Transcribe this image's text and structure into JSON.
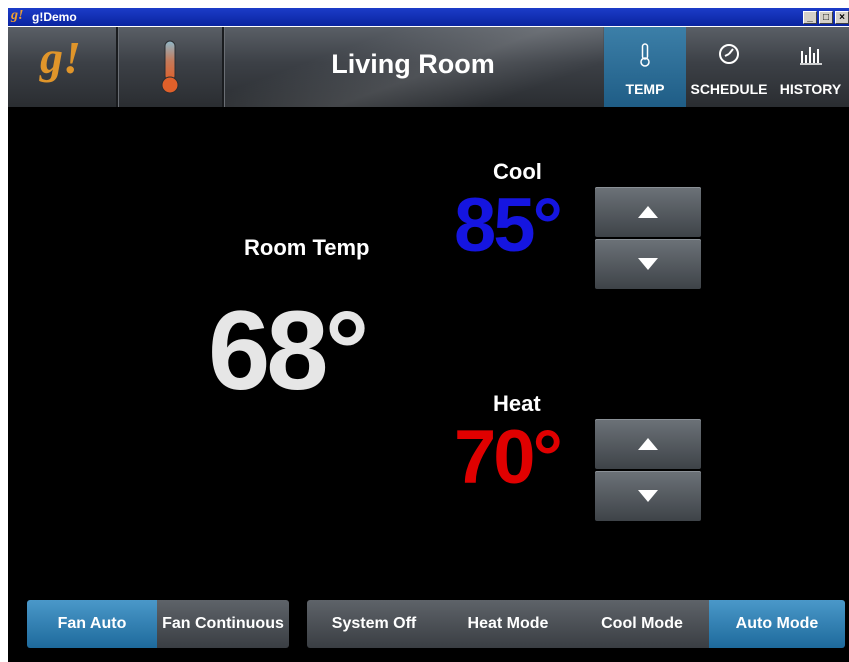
{
  "window": {
    "title": "g!Demo",
    "logo_text": "g!",
    "controls": [
      "_",
      "□",
      "×"
    ]
  },
  "header": {
    "brand": "g!",
    "room_name": "Living Room",
    "tabs": [
      {
        "label": "TEMP",
        "icon": "thermometer-icon",
        "active": true
      },
      {
        "label": "SCHEDULE",
        "icon": "clock-icon",
        "active": false
      },
      {
        "label": "HISTORY",
        "icon": "bar-chart-icon",
        "active": false
      }
    ]
  },
  "room": {
    "label": "Room Temp",
    "value": "68°"
  },
  "cool": {
    "label": "Cool",
    "value": "85°",
    "color": "#1515e0"
  },
  "heat": {
    "label": "Heat",
    "value": "70°",
    "color": "#e00000"
  },
  "fan": {
    "options": [
      {
        "label": "Fan Auto",
        "active": true
      },
      {
        "label": "Fan Continuous",
        "active": false
      }
    ]
  },
  "mode": {
    "options": [
      {
        "label": "System Off",
        "active": false
      },
      {
        "label": "Heat Mode",
        "active": false
      },
      {
        "label": "Cool Mode",
        "active": false
      },
      {
        "label": "Auto Mode",
        "active": true
      }
    ]
  },
  "colors": {
    "accent": "#2a7fb5",
    "background": "#000000",
    "room_temp": "#e6e6e6"
  }
}
